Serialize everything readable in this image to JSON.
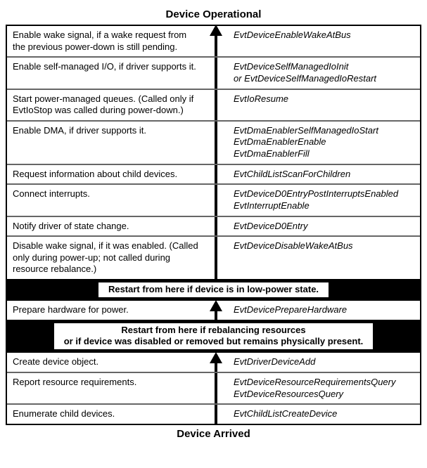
{
  "title_top": "Device Operational",
  "title_bottom": "Device Arrived",
  "section1": [
    {
      "left": "Enable wake signal, if a wake request from the previous power-down is still pending.",
      "right": [
        "EvtDeviceEnableWakeAtBus"
      ]
    },
    {
      "left": "Enable self-managed I/O, if driver supports it.",
      "right": [
        "EvtDeviceSelfManagedIoInit",
        "or EvtDeviceSelfManagedIoRestart"
      ],
      "right_join": " "
    },
    {
      "left": "Start power-managed queues. (Called only if EvtIoStop was called during power-down.)",
      "right": [
        "EvtIoResume"
      ]
    },
    {
      "left": "Enable DMA, if driver supports it.",
      "right": [
        "EvtDmaEnablerSelfManagedIoStart",
        "EvtDmaEnablerEnable",
        "EvtDmaEnablerFill"
      ]
    },
    {
      "left": "Request information about child devices.",
      "right": [
        "EvtChildListScanForChildren"
      ]
    },
    {
      "left": "Connect interrupts.",
      "right": [
        "EvtDeviceD0EntryPostInterruptsEnabled",
        "EvtInterruptEnable"
      ]
    },
    {
      "left": "Notify driver of state change.",
      "right": [
        "EvtDeviceD0Entry"
      ]
    },
    {
      "left": "Disable wake signal, if it was enabled. (Called only during power-up; not called during resource rebalance.)",
      "right": [
        "EvtDeviceDisableWakeAtBus"
      ]
    }
  ],
  "banner1": "Restart from here if device is in low-power state.",
  "section2": [
    {
      "left": "Prepare hardware for power.",
      "right": [
        "EvtDevicePrepareHardware"
      ]
    }
  ],
  "banner2a": "Restart from here if rebalancing resources",
  "banner2b": "or if device was disabled or removed but remains physically present.",
  "section3": [
    {
      "left": "Create device object.",
      "right": [
        "EvtDriverDeviceAdd"
      ]
    },
    {
      "left": "Report resource requirements.",
      "right": [
        "EvtDeviceResourceRequirementsQuery",
        "EvtDeviceResourcesQuery"
      ]
    },
    {
      "left": "Enumerate child devices.",
      "right": [
        "EvtChildListCreateDevice"
      ]
    }
  ]
}
